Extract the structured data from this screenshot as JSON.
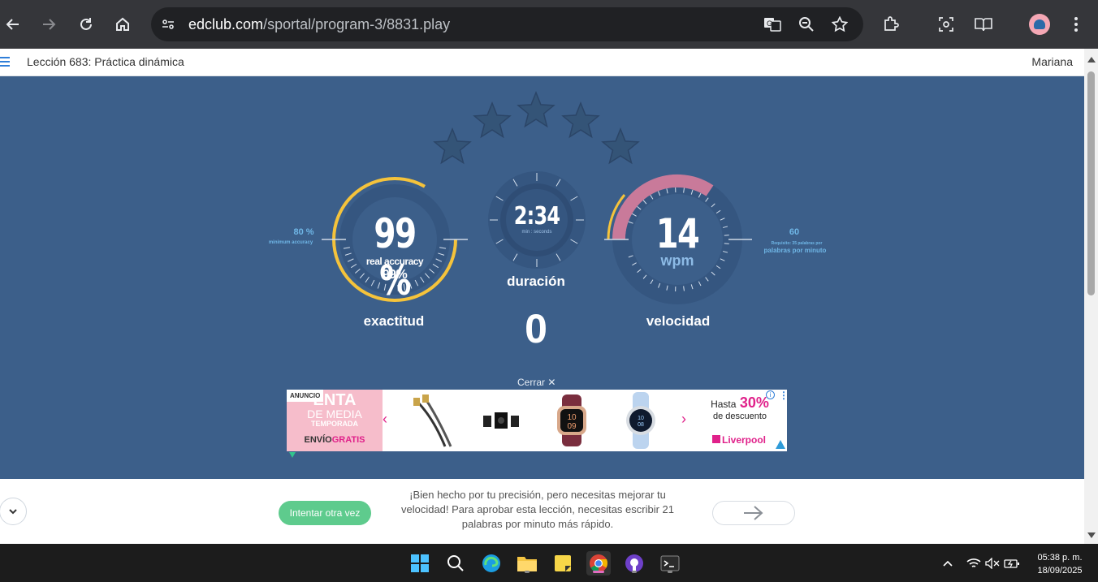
{
  "browser": {
    "url_host": "edclub.com",
    "url_path": "/sportal/program-3/8831.play",
    "back_icon": "arrow-left-icon",
    "forward_icon": "arrow-right-icon",
    "reload_icon": "reload-icon",
    "home_icon": "home-icon"
  },
  "header": {
    "lesson_title": "Lección 683: Práctica dinámica",
    "user_name": "Mariana"
  },
  "results": {
    "stars_total": 5,
    "stars_earned": 0,
    "accuracy": {
      "value": "99 %",
      "sub_label": "real accuracy",
      "sub_value": "99%",
      "label": "exactitud",
      "minimum_value": "80 %",
      "minimum_label": "minimum accuracy",
      "percent": 99
    },
    "duration": {
      "value": "2:34",
      "unit": "min : seconds",
      "label": "duración",
      "counter": "0"
    },
    "speed": {
      "value": "14",
      "unit": "wpm",
      "label": "velocidad",
      "required_value": "60",
      "required_note": "Requisito: 35 palabras por",
      "required_label": "palabras por minuto"
    }
  },
  "ad": {
    "close_label": "Cerrar",
    "badge": "ANUNCIO",
    "left_line1": "ENTA",
    "left_line2": "DE MEDIA",
    "left_line3": "TEMPORADA",
    "left_ship_a": "ENVÍO",
    "left_ship_b": "GRATIS",
    "watch_time": "10\n09",
    "offer_prefix": "Hasta",
    "offer_percent": "30%",
    "offer_suffix": "de descuento",
    "brand": "Liverpool"
  },
  "footer": {
    "retry_label": "Intentar otra vez",
    "feedback": "¡Bien hecho por tu precisión, pero necesitas mejorar tu velocidad! Para aprobar esta lección, necesitas escribir 21 palabras por minuto más rápido."
  },
  "taskbar": {
    "time": "05:38 p. m.",
    "date": "18/09/2025"
  },
  "colors": {
    "page_bg": "#3c5f8a",
    "accuracy_ring": "#f5c33b",
    "speed_ring": "#c97a9a",
    "retry_green": "#5ecb8d",
    "label_blue": "#6fb6e6"
  }
}
